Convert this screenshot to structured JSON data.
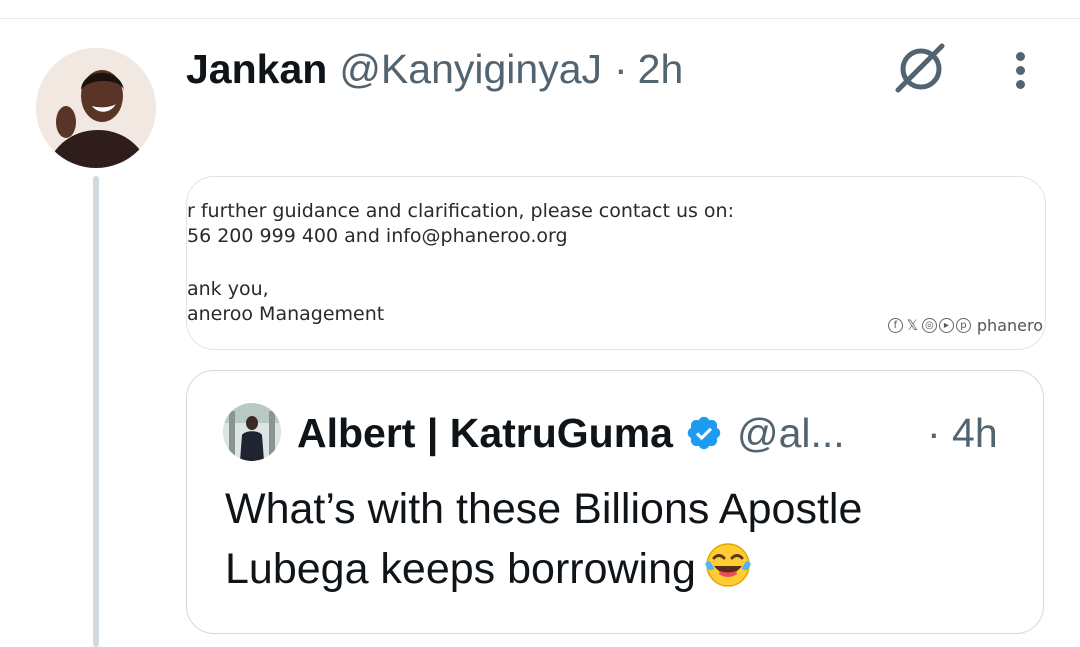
{
  "tweet": {
    "author_name": "Jankan",
    "author_handle": "@KanyiginyaJ",
    "separator": "·",
    "time": "2h",
    "grok_icon": "grok-icon",
    "more_icon": "more-dots-icon"
  },
  "media": {
    "lines": [
      "r further guidance and clarification, please contact us on:",
      "56 200 999 400 and info@phaneroo.org",
      "ank you,",
      "aneroo Management"
    ],
    "social_brand": "phanero",
    "social_icons": [
      "facebook-icon",
      "x-icon",
      "instagram-icon",
      "youtube-icon",
      "pinterest-icon"
    ]
  },
  "quote": {
    "author_name": "Albert | KatruGuma",
    "verified_icon": "verified-badge-icon",
    "author_handle": "@al...",
    "time": "· 4h",
    "text": "What’s with these Billions Apostle Lubega keeps borrowing",
    "emoji": "face-with-tears-of-joy-emoji"
  },
  "colors": {
    "secondary_text": "#536471",
    "verified_blue": "#1d9bf0",
    "thread_line": "#cfd9de",
    "card_border": "#cfd9de"
  }
}
